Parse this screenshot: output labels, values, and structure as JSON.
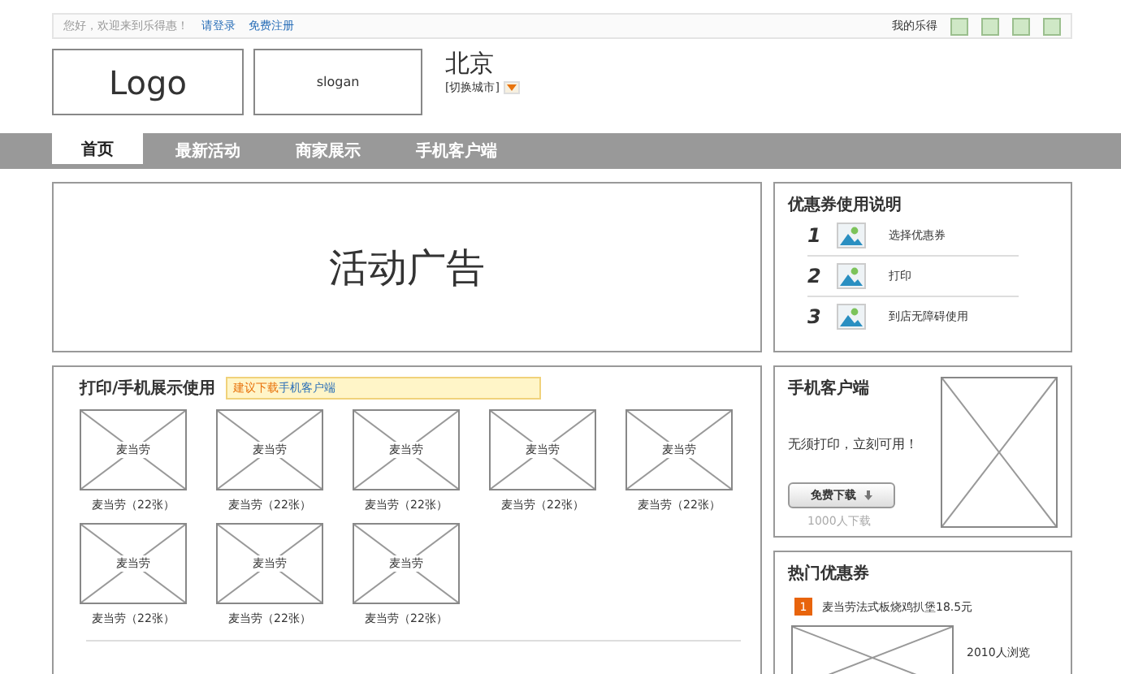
{
  "topbar": {
    "greeting": "您好，欢迎来到乐得惠！",
    "links": [
      "请登录",
      "免费注册"
    ],
    "my_account": "我的乐得"
  },
  "header": {
    "logo": "Logo",
    "slogan": "slogan",
    "city": "北京",
    "switch_city": "[切换城市]"
  },
  "nav": [
    {
      "label": "首页",
      "selected": true
    },
    {
      "label": "最新活动",
      "selected": false
    },
    {
      "label": "商家展示",
      "selected": false
    },
    {
      "label": "手机客户端",
      "selected": false
    }
  ],
  "banner": {
    "text": "活动广告"
  },
  "coupon_guide": {
    "title": "优惠券使用说明",
    "steps": [
      {
        "number": "1",
        "label": "选择优惠券"
      },
      {
        "number": "2",
        "label": "打印"
      },
      {
        "number": "3",
        "label": "到店无障碍使用"
      }
    ]
  },
  "print_panel": {
    "title": "打印/手机展示使用",
    "tip_prefix": "建议下载",
    "tip_link": "手机客户端",
    "items": [
      {
        "image_label": "麦当劳",
        "caption": "麦当劳（22张）"
      },
      {
        "image_label": "麦当劳",
        "caption": "麦当劳（22张）"
      },
      {
        "image_label": "麦当劳",
        "caption": "麦当劳（22张）"
      },
      {
        "image_label": "麦当劳",
        "caption": "麦当劳（22张）"
      },
      {
        "image_label": "麦当劳",
        "caption": "麦当劳（22张）"
      },
      {
        "image_label": "麦当劳",
        "caption": "麦当劳（22张）"
      },
      {
        "image_label": "麦当劳",
        "caption": "麦当劳（22张）"
      },
      {
        "image_label": "麦当劳",
        "caption": "麦当劳（22张）"
      }
    ]
  },
  "mobile_panel": {
    "title": "手机客户端",
    "text": "无须打印，立刻可用！",
    "button": "免费下载",
    "downloads": "1000人下载"
  },
  "hot_coupons": {
    "title": "热门优惠券",
    "items": [
      {
        "rank": "1",
        "name": "麦当劳法式板烧鸡扒堡18.5元",
        "views": "2010人浏览"
      }
    ]
  }
}
